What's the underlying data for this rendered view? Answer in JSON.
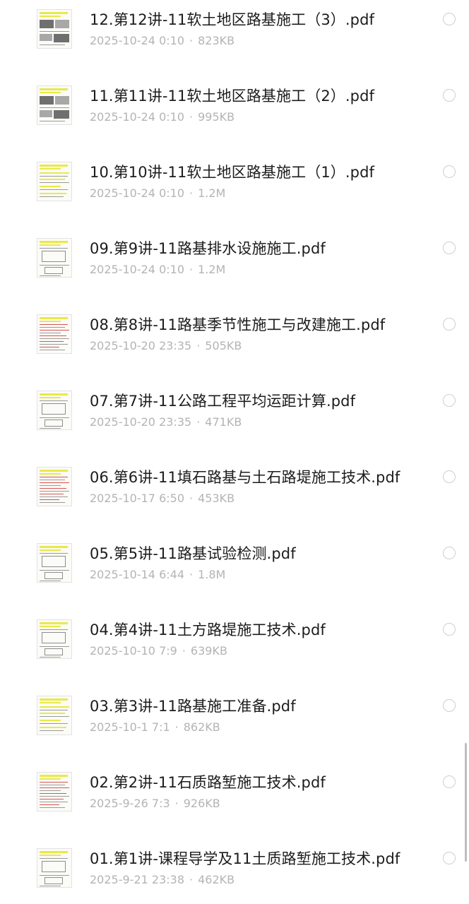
{
  "files": [
    {
      "name": "12.第12讲-11软土地区路基施工（3）.pdf",
      "date": "2025-10-24 0:10",
      "size": "823KB",
      "thumb": "photo"
    },
    {
      "name": "11.第11讲-11软土地区路基施工（2）.pdf",
      "date": "2025-10-24 0:10",
      "size": "995KB",
      "thumb": "photo"
    },
    {
      "name": "10.第10讲-11软土地区路基施工（1）.pdf",
      "date": "2025-10-24 0:10",
      "size": "1.2M",
      "thumb": "text"
    },
    {
      "name": "09.第9讲-11路基排水设施施工.pdf",
      "date": "2025-10-24 0:10",
      "size": "1.2M",
      "thumb": "sketch"
    },
    {
      "name": "08.第8讲-11路基季节性施工与改建施工.pdf",
      "date": "2025-10-20 23:35",
      "size": "505KB",
      "thumb": "red"
    },
    {
      "name": "07.第7讲-11公路工程平均运距计算.pdf",
      "date": "2025-10-20 23:35",
      "size": "471KB",
      "thumb": "sketch"
    },
    {
      "name": "06.第6讲-11填石路基与土石路堤施工技术.pdf",
      "date": "2025-10-17 6:50",
      "size": "453KB",
      "thumb": "red"
    },
    {
      "name": "05.第5讲-11路基试验检测.pdf",
      "date": "2025-10-14 6:44",
      "size": "1.8M",
      "thumb": "sketch"
    },
    {
      "name": "04.第4讲-11土方路堤施工技术.pdf",
      "date": "2025-10-10 7:9",
      "size": "639KB",
      "thumb": "sketch"
    },
    {
      "name": "03.第3讲-11路基施工准备.pdf",
      "date": "2025-10-1 7:1",
      "size": "862KB",
      "thumb": "text"
    },
    {
      "name": "02.第2讲-11石质路堑施工技术.pdf",
      "date": "2025-9-26 7:3",
      "size": "926KB",
      "thumb": "red"
    },
    {
      "name": "01.第1讲-课程导学及11土质路堑施工技术.pdf",
      "date": "2025-9-21 23:38",
      "size": "462KB",
      "thumb": "sketch"
    }
  ],
  "meta_separator": "·",
  "colors": {
    "title": "#1c1c1c",
    "meta": "#b4b4b4",
    "highlight": "#e9e94a",
    "circle": "#cfcfcf"
  },
  "icons": {
    "thumbnail": "pdf-thumbnail-icon",
    "select": "select-circle-icon"
  }
}
